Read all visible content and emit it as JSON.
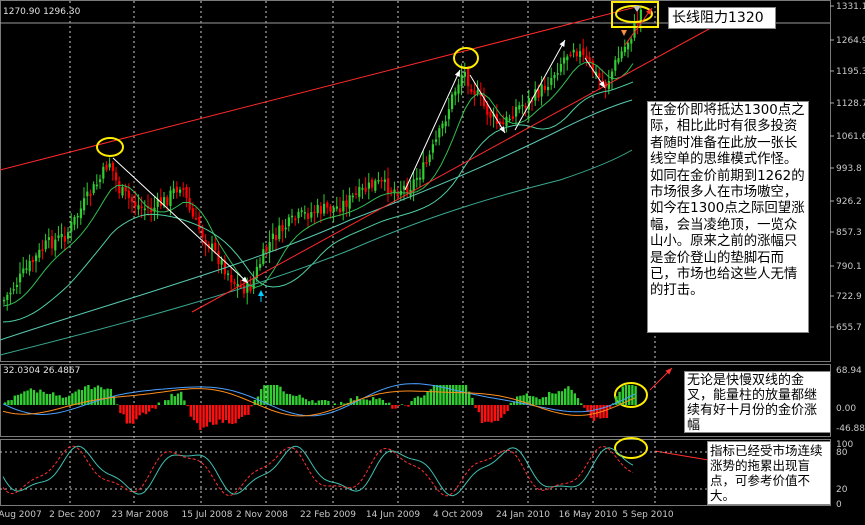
{
  "chart": {
    "header_left": "1270.90 1296.30",
    "price_ticks": [
      "1331.1",
      "1264.9",
      "1195.3",
      "1128.7",
      "1061.6",
      "993.8",
      "926.2",
      "857.3",
      "790.1",
      "722.9",
      "655.7"
    ],
    "macd_header": "32.0304 26.4867",
    "macd_ticks": [
      "68.94",
      "0.00",
      "-46.88"
    ],
    "stoch_ticks": [
      "100",
      "80",
      "20",
      "0"
    ],
    "date_labels": [
      "Aug 2007",
      "2 Dec 2007",
      "23 Mar 2008",
      "15 Jul 2008",
      "2 Nov 2008",
      "22 Feb 2009",
      "14 Jun 2009",
      "4 Oct 2009",
      "24 Jan 2010",
      "16 May 2010",
      "5 Sep 2010"
    ]
  },
  "annotations": {
    "resistance_label": "长线阻力1320",
    "main_comment": "在金价即将抵达1300点之际，相比此时有很多投资者随时准备在此放一张长线空单的思维模式作怪。如同在金价前期到1262的市场很多人在市场嗷空，如今在1300点之际回望涨幅，会当凌绝顶，一览众山小。原来之前的涨幅只是金价登山的垫脚石而已，市场也给这些人无情的打击。",
    "macd_comment": "无论是快慢双线的金叉，能量柱的放量都继续有好十月份的金价涨幅",
    "stoch_comment": "指标已经受市场连续涨势的拖累出现盲点，可参考价值不大。"
  },
  "colors": {
    "background": "#000000",
    "bull_candle": "#32cd32",
    "bear_candle": "#ff0000",
    "resistance_line": "#ff2a2a",
    "highlight_circle": "#ffee00",
    "macd_line": "#4aa0ff",
    "signal_line": "#ff8c1a"
  }
}
